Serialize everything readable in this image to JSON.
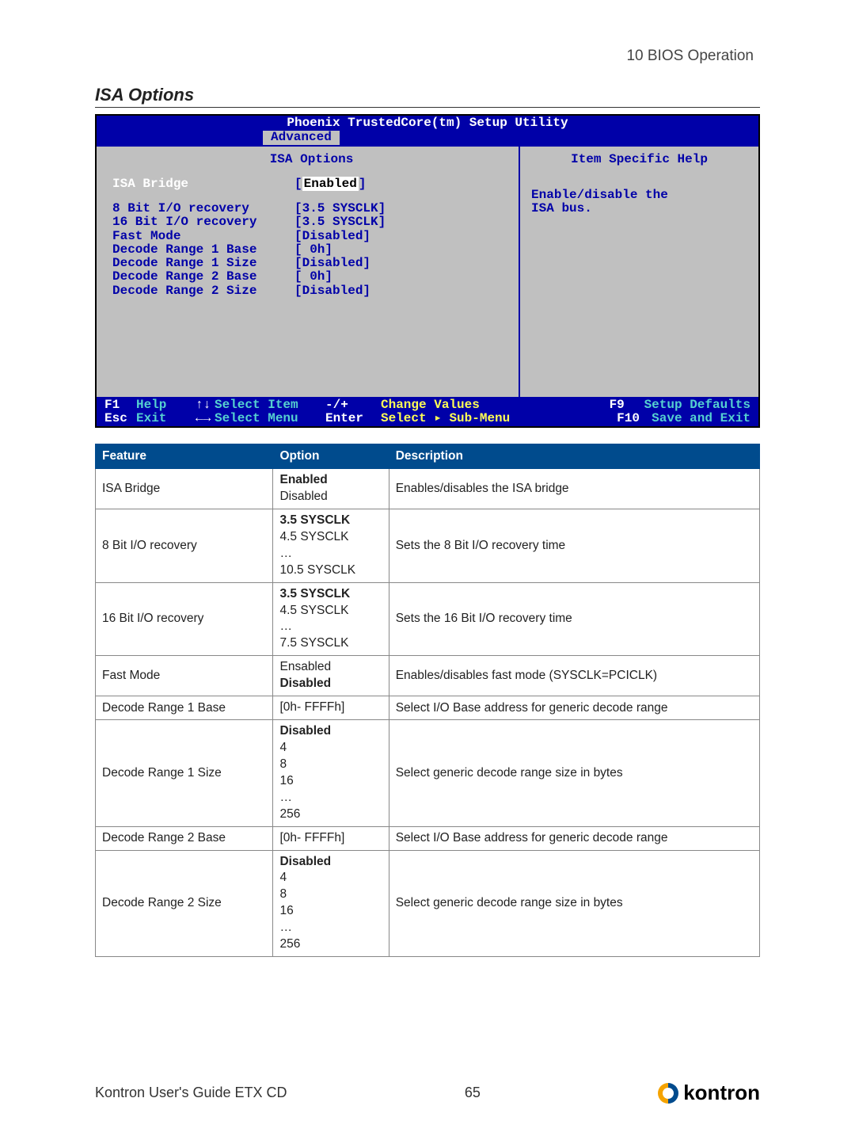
{
  "header": {
    "chapter": "10 BIOS Operation"
  },
  "section": {
    "title": "ISA Options"
  },
  "bios": {
    "title": "Phoenix TrustedCore(tm) Setup Utility",
    "active_tab": "Advanced",
    "left_title": "ISA Options",
    "right_title": "Item Specific Help",
    "help_line1": "Enable/disable the",
    "help_line2": "ISA bus.",
    "rows": {
      "r0_label": "ISA Bridge",
      "r0_val": "Enabled",
      "r1_label": "8  Bit I/O recovery",
      "r1_val": "[3.5 SYSCLK]",
      "r2_label": "16 Bit I/O recovery",
      "r2_val": "[3.5 SYSCLK]",
      "r3_label": "Fast Mode",
      "r3_val": "[Disabled]",
      "r4_label": "Decode Range 1 Base",
      "r4_val": "[   0h]",
      "r5_label": "Decode Range 1 Size",
      "r5_val": "[Disabled]",
      "r6_label": "Decode Range 2 Base",
      "r6_val": "[   0h]",
      "r7_label": "Decode Range 2 Size",
      "r7_val": "[Disabled]"
    },
    "footer": {
      "f1_k": "F1",
      "f1_t": "Help",
      "f1_a": "↑↓",
      "f1_l": "Select Item",
      "f1_m": "-/+",
      "f1_n": "Change Values",
      "f1_p": "F9",
      "f1_q": "Setup Defaults",
      "f2_k": "Esc",
      "f2_t": "Exit",
      "f2_a": "←→",
      "f2_l": "Select Menu",
      "f2_m": "Enter",
      "f2_n": "Select ▸ Sub-Menu",
      "f2_p": "F10",
      "f2_q": "Save and Exit"
    }
  },
  "table": {
    "h1": "Feature",
    "h2": "Option",
    "h3": "Description",
    "r1f": "ISA Bridge",
    "r1o1": "Enabled",
    "r1o2": "Disabled",
    "r1d": "Enables/disables the ISA bridge",
    "r2f": "8 Bit I/O recovery",
    "r2o1": "3.5 SYSCLK",
    "r2o2": "4.5 SYSCLK",
    "r2o3": "…",
    "r2o4": "10.5 SYSCLK",
    "r2d": "Sets the 8 Bit I/O recovery time",
    "r3f": "16 Bit I/O recovery",
    "r3o1": "3.5 SYSCLK",
    "r3o2": "4.5 SYSCLK",
    "r3o3": "…",
    "r3o4": "7.5 SYSCLK",
    "r3d": "Sets the 16 Bit I/O recovery time",
    "r4f": "Fast Mode",
    "r4o1": "Ensabled",
    "r4o2": "Disabled",
    "r4d": "Enables/disables fast mode (SYSCLK=PCICLK)",
    "r5f": "Decode Range 1 Base",
    "r5o": "[0h- FFFFh]",
    "r5d": "Select I/O Base address for generic decode range",
    "r6f": "Decode Range 1 Size",
    "r6o1": "Disabled",
    "r6o2": "4",
    "r6o3": "8",
    "r6o4": "16",
    "r6o5": "…",
    "r6o6": "256",
    "r6d": "Select generic decode range size in bytes",
    "r7f": "Decode Range 2 Base",
    "r7o": "[0h- FFFFh]",
    "r7d": "Select I/O Base address for generic decode range",
    "r8f": "Decode Range 2 Size",
    "r8o1": "Disabled",
    "r8o2": "4",
    "r8o3": "8",
    "r8o4": "16",
    "r8o5": "…",
    "r8o6": "256",
    "r8d": "Select generic decode range size in bytes"
  },
  "footer": {
    "guide": "Kontron User's Guide ETX CD",
    "page": "65",
    "brand": "kontron"
  }
}
